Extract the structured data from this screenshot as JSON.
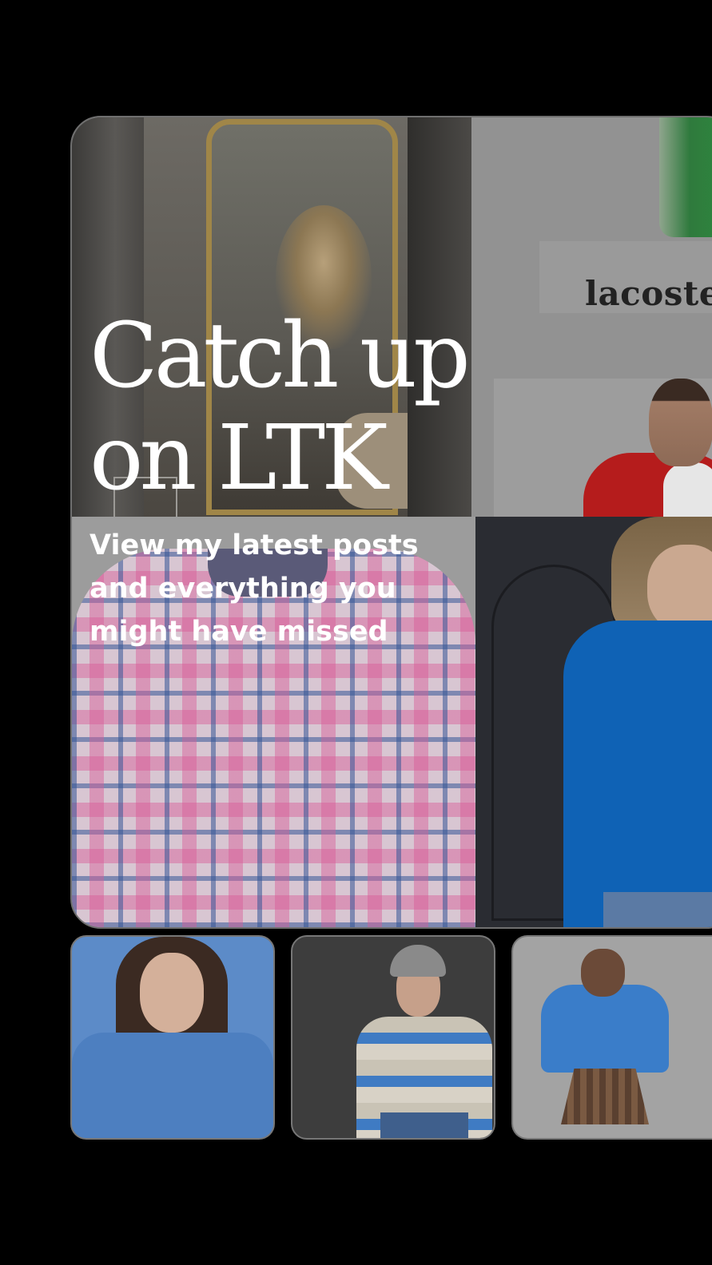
{
  "hero": {
    "headline_line1": "Catch up",
    "headline_line2": "on LTK",
    "subtext_line1": "View my latest posts",
    "subtext_line2": "and everything you",
    "subtext_line3": "might have missed"
  },
  "tiles": {
    "brand_logo": "lacoste"
  },
  "colors": {
    "background": "#000000",
    "card_overlay": "#8f8f8f",
    "headline_text": "#ffffff"
  }
}
